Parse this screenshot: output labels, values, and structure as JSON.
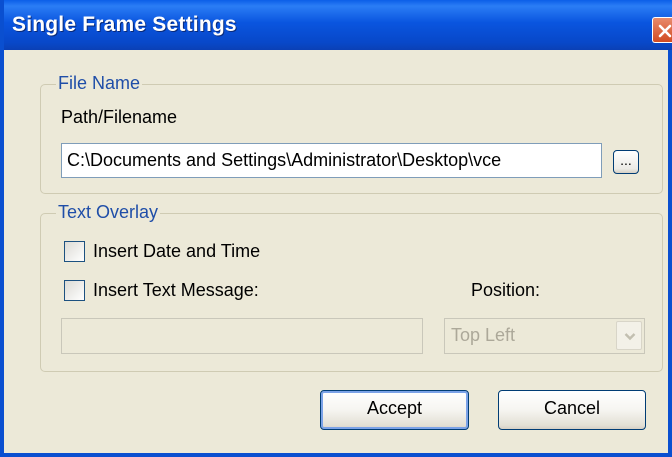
{
  "window": {
    "title": "Single Frame Settings"
  },
  "file_name_group": {
    "label": "File Name",
    "path_label": "Path/Filename",
    "path_value": "C:\\Documents and Settings\\Administrator\\Desktop\\vce",
    "browse_label": "..."
  },
  "text_overlay_group": {
    "label": "Text Overlay",
    "insert_date_time_label": "Insert Date and Time",
    "insert_date_time_checked": false,
    "insert_text_message_label": "Insert Text Message:",
    "insert_text_message_checked": false,
    "text_message_value": "",
    "position_label": "Position:",
    "position_value": "Top Left"
  },
  "buttons": {
    "accept_label": "Accept",
    "cancel_label": "Cancel"
  },
  "icons": {
    "close": "close-icon",
    "dropdown": "chevron-down-icon"
  },
  "colors": {
    "titlebar": "#0a55df",
    "close_button": "#d14b22",
    "group_label": "#1f4ea8",
    "dialog_background": "#ece9d8"
  }
}
